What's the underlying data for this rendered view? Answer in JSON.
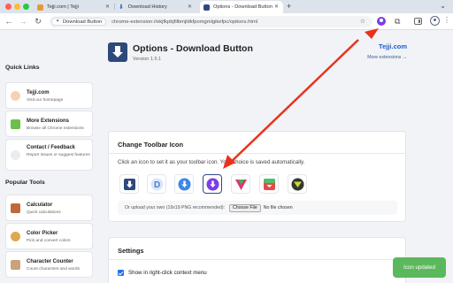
{
  "browser": {
    "tabs": [
      {
        "title": "Tejji.com | Tejji",
        "active": false
      },
      {
        "title": "Download History",
        "active": false
      },
      {
        "title": "Options - Download Button",
        "active": true
      }
    ],
    "omnibox": {
      "chip_label": "Download Button",
      "url": "chrome-extension://ekjfkpbjfilbmjldkfpomgmlgikefpc/options.html"
    }
  },
  "sidebar": {
    "quick_links_title": "Quick Links",
    "quick_links": [
      {
        "title": "Tejji.com",
        "desc": "Visit our homepage",
        "icon": "tejji-avatar-icon"
      },
      {
        "title": "More Extensions",
        "desc": "Browse all Chrome extensions",
        "icon": "puzzle-icon"
      },
      {
        "title": "Contact / Feedback",
        "desc": "Report issues or suggest features",
        "icon": "speech-bubble-icon"
      }
    ],
    "popular_tools_title": "Popular Tools",
    "popular_tools": [
      {
        "title": "Calculator",
        "desc": "Quick calculations",
        "icon": "calculator-icon"
      },
      {
        "title": "Color Picker",
        "desc": "Pick and convert colors",
        "icon": "palette-icon"
      },
      {
        "title": "Character Counter",
        "desc": "Count characters and words",
        "icon": "document-icon"
      }
    ]
  },
  "header": {
    "title": "Options - Download Button",
    "version": "Version 1.5.1",
    "brand_link": "Tejji.com",
    "more_extensions_link": "More extensions →"
  },
  "toolbar_icon": {
    "section_title": "Change Toolbar Icon",
    "instruction": "Click an icon to set it as your toolbar icon. Your choice is saved automatically.",
    "icons": [
      {
        "name": "navy-square-arrow-icon",
        "selected": false
      },
      {
        "name": "blue-letter-d-icon",
        "selected": false
      },
      {
        "name": "blue-circle-arrow-icon",
        "selected": false
      },
      {
        "name": "purple-circle-arrow-icon",
        "selected": true
      },
      {
        "name": "green-pink-triangle-icon",
        "selected": false
      },
      {
        "name": "green-red-box-icon",
        "selected": false
      },
      {
        "name": "yellow-dark-circle-icon",
        "selected": false
      }
    ],
    "upload_label": "Or upload your own (19x19 PNG recommended):",
    "choose_file_label": "Choose File",
    "no_file_label": "No file chosen"
  },
  "settings": {
    "section_title": "Settings",
    "context_menu_label": "Show in right-click context menu",
    "context_menu_checked": true
  },
  "toast": {
    "message": "Icon updated"
  },
  "colors": {
    "accent_blue": "#1a5fd0",
    "navy": "#2c4a7a",
    "purple": "#7b3fe4",
    "toast_green": "#5cb85c",
    "arrow_red": "#e8321e"
  }
}
